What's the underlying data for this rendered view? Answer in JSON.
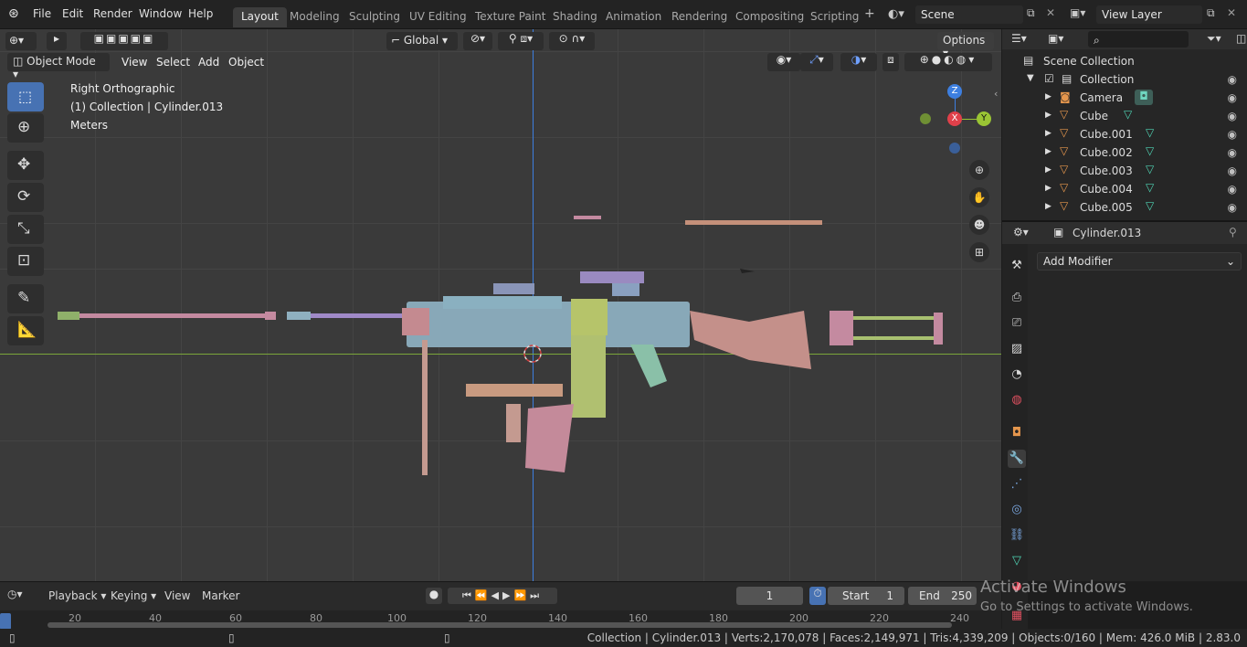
{
  "menubar": {
    "items": [
      "File",
      "Edit",
      "Render",
      "Window",
      "Help"
    ],
    "workspaces": [
      "Layout",
      "Modeling",
      "Sculpting",
      "UV Editing",
      "Texture Paint",
      "Shading",
      "Animation",
      "Rendering",
      "Compositing",
      "Scripting"
    ],
    "active_workspace": "Layout",
    "add_tab": "+",
    "scene_name": "Scene",
    "view_layer": "View Layer"
  },
  "header": {
    "transform_orientation": "Global",
    "options_label": "Options",
    "mode": "Object Mode",
    "menus": [
      "View",
      "Select",
      "Add",
      "Object"
    ]
  },
  "viewport": {
    "view_name": "Right Orthographic",
    "context": "(1) Collection | Cylinder.013",
    "units": "Meters",
    "gizmo": {
      "z": "Z",
      "x": "X",
      "y": "Y"
    }
  },
  "outliner": {
    "root": "Scene Collection",
    "collection": "Collection",
    "items": [
      "Camera",
      "Cube",
      "Cube.001",
      "Cube.002",
      "Cube.003",
      "Cube.004",
      "Cube.005"
    ]
  },
  "properties": {
    "object_name": "Cylinder.013",
    "add_modifier": "Add Modifier"
  },
  "timeline": {
    "menus": [
      "Playback",
      "Keying",
      "View",
      "Marker"
    ],
    "current_frame": "1",
    "start_label": "Start",
    "start_value": "1",
    "end_label": "End",
    "end_value": "250",
    "ticks": [
      "20",
      "40",
      "60",
      "80",
      "100",
      "120",
      "140",
      "160",
      "180",
      "200",
      "220",
      "240"
    ]
  },
  "statusbar": {
    "text": "Collection | Cylinder.013 | Verts:2,170,078 | Faces:2,149,971 | Tris:4,339,209 | Objects:0/160 | Mem: 426.0 MiB | 2.83.0"
  },
  "watermark": {
    "title": "Activate Windows",
    "subtitle": "Go to Settings to activate Windows."
  },
  "colors": {
    "accent": "#4772b3",
    "axis_x": "#e0404a",
    "axis_y": "#9ac534",
    "axis_z": "#3d7fe0"
  }
}
